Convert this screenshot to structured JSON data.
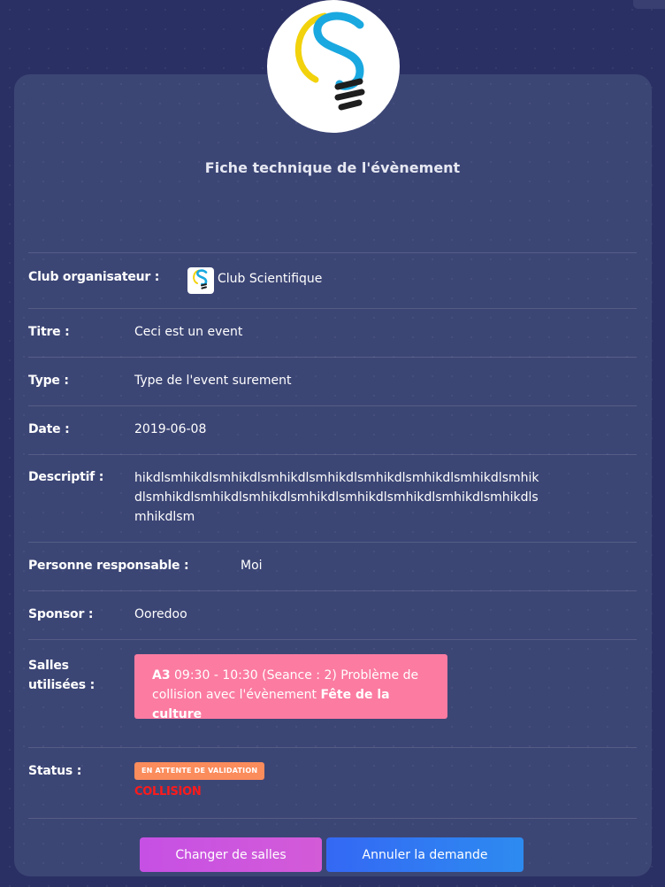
{
  "page": {
    "title": "Fiche technique de l'évènement"
  },
  "logo": {
    "icon": "lightbulb-logo-icon",
    "colors": {
      "yellow": "#f2d20c",
      "blue": "#1aa8e0",
      "black": "#1e1e1e"
    }
  },
  "fields": {
    "club": {
      "label": "Club organisateur :",
      "value": "Club Scientifique"
    },
    "titre": {
      "label": "Titre :",
      "value": "Ceci est un event"
    },
    "type": {
      "label": "Type :",
      "value": "Type de l'event surement"
    },
    "date": {
      "label": "Date :",
      "value": "2019-06-08"
    },
    "descriptif": {
      "label": "Descriptif :",
      "value": "hikdlsmhikdlsmhikdlsmhikdlsmhikdlsmhikdlsmhikdlsmhikdlsmhikdlsmhikdlsmhikdlsmhikdlsmhikdlsmhikdlsmhikdlsmhikdlsmhikdlsmhikdlsm"
    },
    "responsable": {
      "label": "Personne responsable :",
      "value": "Moi"
    },
    "sponsor": {
      "label": "Sponsor :",
      "value": "Ooredoo"
    },
    "salles": {
      "label_line1": "Salles",
      "label_line2": "utilisées :",
      "room": "A3",
      "time_text": " 09:30 - 10:30 (Seance : 2) Problème de collision avec l'évènement ",
      "conflict_event": "Fête de la culture"
    },
    "status": {
      "label": "Status :",
      "badge": "EN ATTENTE DE VALIDATION",
      "collision": "COLLISION"
    }
  },
  "buttons": {
    "change": "Changer de salles",
    "cancel": "Annuler la demande"
  },
  "colors": {
    "background": "#2b3064",
    "card": "#3c4675",
    "alert": "#fb7ba1",
    "badge": "#fb8c5c",
    "collision": "#ff1a1a"
  }
}
